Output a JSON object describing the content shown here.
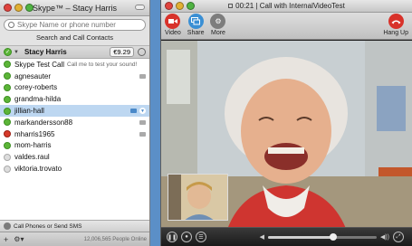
{
  "contacts_window": {
    "title": "Skype™ – Stacy Harris",
    "search": {
      "placeholder": "Skype Name or phone number",
      "button_label": "Search and Call Contacts"
    },
    "user": {
      "name": "Stacy Harris",
      "credit": "€9.29"
    },
    "contacts": [
      {
        "name": "Skype Test Call",
        "mood": "Call me to test your sound!",
        "status": "online",
        "video": false,
        "selected": false
      },
      {
        "name": "agnesauter",
        "mood": "",
        "status": "online",
        "video": true,
        "selected": false
      },
      {
        "name": "corey-roberts",
        "mood": "",
        "status": "online",
        "video": false,
        "selected": false
      },
      {
        "name": "grandma-hilda",
        "mood": "",
        "status": "online",
        "video": false,
        "selected": false
      },
      {
        "name": "jillian-hall",
        "mood": "",
        "status": "online",
        "video": true,
        "selected": true
      },
      {
        "name": "markandersson88",
        "mood": "",
        "status": "online",
        "video": true,
        "selected": false
      },
      {
        "name": "mharris1965",
        "mood": "",
        "status": "busy",
        "video": true,
        "selected": false
      },
      {
        "name": "mom-harris",
        "mood": "",
        "status": "online",
        "video": false,
        "selected": false
      },
      {
        "name": "valdes.raul",
        "mood": "",
        "status": "offline",
        "video": false,
        "selected": false
      },
      {
        "name": "viktoria.trovato",
        "mood": "",
        "status": "offline",
        "video": false,
        "selected": false
      }
    ],
    "call_phones_label": "Call Phones or Send SMS",
    "online_count": "12,006,565 People Online"
  },
  "call_window": {
    "timer": "00:21",
    "title_separator": "|",
    "call_title": "Call with InternalVideoTest",
    "toolbar": {
      "video_label": "Video",
      "share_label": "Share",
      "more_label": "More",
      "hangup_label": "Hang Up"
    },
    "volume_level": 0.6
  },
  "colors": {
    "online": "#5cb538",
    "busy": "#d63a2a",
    "selection": "#bdd7f1",
    "hangup": "#d8322a",
    "share": "#3a8fd4"
  }
}
